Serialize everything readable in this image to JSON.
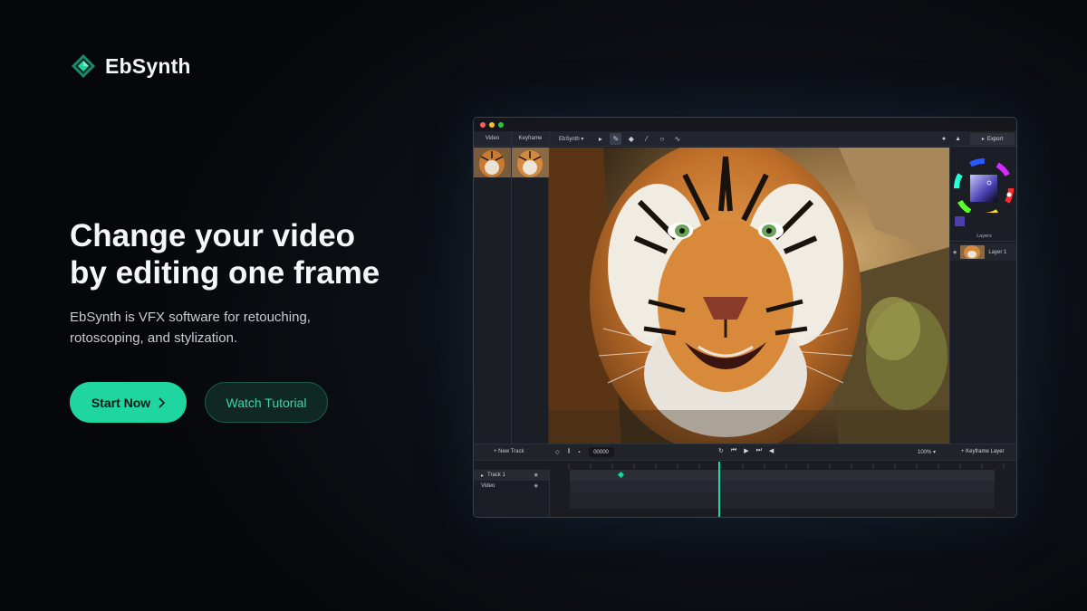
{
  "brand": {
    "name": "EbSynth",
    "accent": "#1fd6a1"
  },
  "hero": {
    "headline_line1": "Change your video",
    "headline_line2": "by editing one frame",
    "subtitle_line1": "EbSynth is VFX software for retouching,",
    "subtitle_line2": "rotoscoping, and stylization.",
    "primary_cta": "Start Now",
    "secondary_cta": "Watch Tutorial"
  },
  "app": {
    "tabs": [
      "Video",
      "Keyframe"
    ],
    "mode_dropdown": "EbSynth",
    "export_label": "Export",
    "layers_title": "Layers",
    "layer_name": "Layer 1",
    "swatch_color": "#4b3fb0",
    "timeline": {
      "new_track_label": "New Track",
      "frame_value": "00000",
      "zoom_value": "100%",
      "keyframe_layer_label": "Keyframe Layer",
      "tracks": [
        {
          "label": "Track 1"
        },
        {
          "label": "Video"
        }
      ]
    }
  }
}
